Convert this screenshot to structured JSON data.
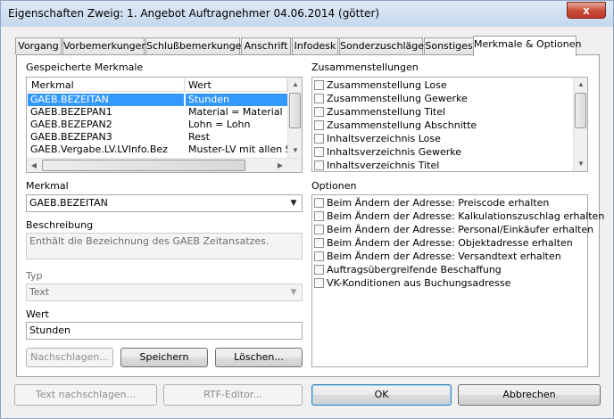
{
  "window": {
    "title": "Eigenschaften Zweig: 1. Angebot Auftragnehmer 04.06.2014 (götter)",
    "close": "x"
  },
  "tabs": [
    "Vorgang",
    "Vorbemerkungen",
    "Schlußbemerkungen",
    "Anschrift",
    "Infodesk",
    "Sonderzuschläge",
    "Sonstiges",
    "Merkmale & Optionen"
  ],
  "active_tab": "Merkmale & Optionen",
  "merkmale": {
    "label": "Gespeicherte Merkmale",
    "columns": [
      "Merkmal",
      "Wert"
    ],
    "rows": [
      [
        "GAEB.BEZEITAN",
        "Stunden"
      ],
      [
        "GAEB.BEZEPAN1",
        "Material = Material"
      ],
      [
        "GAEB.BEZEPAN2",
        "Lohn = Lohn"
      ],
      [
        "GAEB.BEZEPAN3",
        "Rest"
      ],
      [
        "GAEB.Vergabe.LV.LVInfo.Bez",
        "Muster-LV mit allen Son"
      ]
    ],
    "selected_row": 0
  },
  "zusammenstellungen": {
    "label": "Zusammenstellungen",
    "items": [
      "Zusammenstellung Lose",
      "Zusammenstellung Gewerke",
      "Zusammenstellung Titel",
      "Zusammenstellung Abschnitte",
      "Inhaltsverzeichnis Lose",
      "Inhaltsverzeichnis Gewerke",
      "Inhaltsverzeichnis Titel"
    ]
  },
  "optionen": {
    "label": "Optionen",
    "items": [
      "Beim Ändern der Adresse: Preiscode erhalten",
      "Beim Ändern der Adresse: Kalkulationszuschlag erhalten",
      "Beim Ändern der Adresse: Personal/Einkäufer erhalten",
      "Beim Ändern der Adresse: Objektadresse erhalten",
      "Beim Ändern der Adresse: Versandtext erhalten",
      "Auftragsübergreifende Beschaffung",
      "VK-Konditionen aus Buchungsadresse"
    ]
  },
  "merkmal_field": {
    "label": "Merkmal",
    "value": "GAEB.BEZEITAN"
  },
  "beschreibung": {
    "label": "Beschreibung",
    "value": "Enthält die Bezeichnung des GAEB Zeitansatzes."
  },
  "typ": {
    "label": "Typ",
    "value": "Text"
  },
  "wert": {
    "label": "Wert",
    "value": "Stunden"
  },
  "panel_buttons": {
    "nachschlagen": "Nachschlagen...",
    "speichern": "Speichern",
    "loeschen": "Löschen..."
  },
  "footer": {
    "text_nachschlagen": "Text nachschlagen...",
    "rtf_editor": "RTF-Editor...",
    "ok": "OK",
    "abbrechen": "Abbrechen"
  }
}
